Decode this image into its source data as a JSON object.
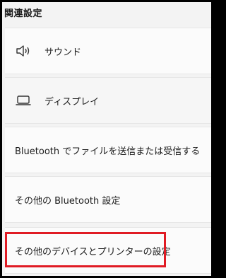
{
  "section": {
    "title": "関連設定"
  },
  "items": [
    {
      "label": "サウンド",
      "icon": "speaker-icon"
    },
    {
      "label": "ディスプレイ",
      "icon": "monitor-icon"
    },
    {
      "label": "Bluetooth でファイルを送信または受信する"
    },
    {
      "label": "その他の Bluetooth 設定"
    },
    {
      "label": "その他のデバイスとプリンターの設定"
    }
  ],
  "colors": {
    "highlight": "#e01b24",
    "card": "#fbfbfb",
    "background": "#f3f3f3"
  }
}
